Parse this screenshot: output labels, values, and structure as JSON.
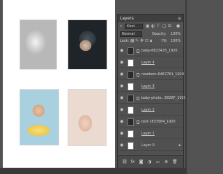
{
  "layers_panel": {
    "title": "Layers",
    "menu_icon": "≡",
    "filter_kind": "Kind",
    "blend_mode": "Normal",
    "opacity_label": "Opacity:",
    "opacity_value": "100%",
    "lock_label": "Lock:",
    "fill_label": "Fill:",
    "fill_value": "100%",
    "layers": [
      {
        "name": "baby-6823425_1920",
        "type": "smart",
        "underline": false,
        "selected": false
      },
      {
        "name": "Layer 4",
        "type": "white",
        "underline": true,
        "selected": false
      },
      {
        "name": "newborn-6467761_1920",
        "type": "smart",
        "underline": false,
        "selected": false
      },
      {
        "name": "Layer 3",
        "type": "white",
        "underline": true,
        "selected": false
      },
      {
        "name": "baby-photo...5026F_1920",
        "type": "smart",
        "underline": false,
        "selected": false
      },
      {
        "name": "Layer 2",
        "type": "white",
        "underline": true,
        "selected": false
      },
      {
        "name": "bed-1833984_1920",
        "type": "smart",
        "underline": false,
        "selected": false
      },
      {
        "name": "Layer 1",
        "type": "white",
        "underline": true,
        "selected": false
      },
      {
        "name": "Layer 0",
        "type": "white",
        "underline": false,
        "selected": false,
        "locked": true
      }
    ],
    "footer_icons": [
      "link-icon",
      "fx-icon",
      "mask-icon",
      "adjustment-icon",
      "folder-icon",
      "new-layer-icon",
      "trash-icon"
    ]
  },
  "colors": {
    "app_bg": "#535353",
    "canvas": "#ffffff",
    "panel_title_bg": "#3f3f3f"
  }
}
